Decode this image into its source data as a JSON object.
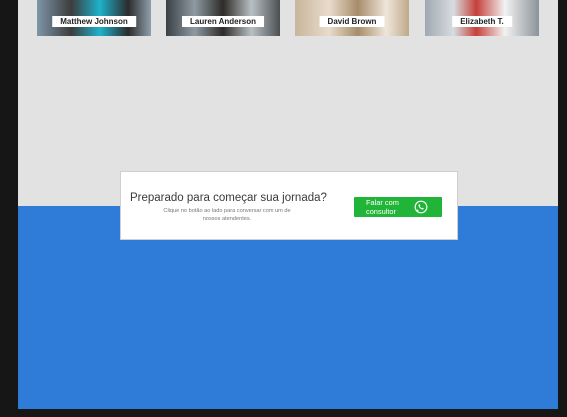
{
  "team": [
    {
      "name": "Matthew Johnson"
    },
    {
      "name": "Lauren Anderson"
    },
    {
      "name": "David Brown"
    },
    {
      "name": "Elizabeth T."
    }
  ],
  "cta": {
    "title": "Preparado para começar sua jornada?",
    "subtitle": "Clique no botão ao lado para conversar com um de nossos atendentes.",
    "button_label": "Falar com consultor",
    "button_icon": "whatsapp-icon",
    "button_color": "#20b538"
  },
  "colors": {
    "page_background": "#161616",
    "section_background": "#e2e2e2",
    "blue_band": "#2f7bd8"
  }
}
